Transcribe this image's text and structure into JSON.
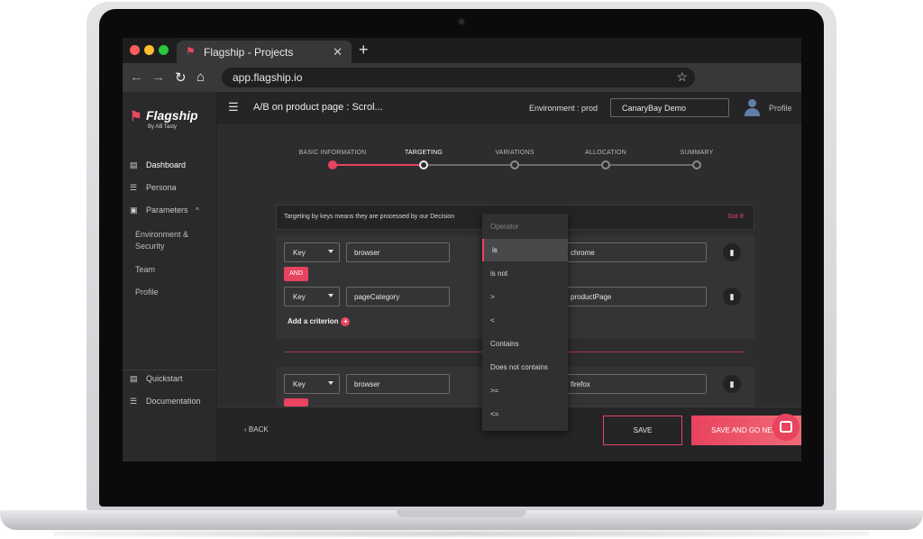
{
  "browser": {
    "tab_title": "Flagship - Projects",
    "url": "app.flagship.io"
  },
  "sidebar": {
    "logo_name": "Flagship",
    "logo_tagline": "By AB Tasty",
    "items": [
      {
        "label": "Dashboard"
      },
      {
        "label": "Persona"
      },
      {
        "label": "Parameters"
      },
      {
        "label": "Environment & Security"
      },
      {
        "label": "Team"
      },
      {
        "label": "Profile"
      },
      {
        "label": "Quickstart"
      },
      {
        "label": "Documentation"
      }
    ]
  },
  "header": {
    "title": "A/B on product page : Scrol...",
    "environment_label": "Environment : prod",
    "environment_value": "CanaryBay Demo",
    "profile_label": "Profile"
  },
  "stepper": {
    "steps": [
      {
        "label": "BASIC INFORMATION",
        "state": "done"
      },
      {
        "label": "TARGETING",
        "state": "current"
      },
      {
        "label": "VARIATIONS",
        "state": "todo"
      },
      {
        "label": "ALLOCATION",
        "state": "todo"
      },
      {
        "label": "SUMMARY",
        "state": "todo"
      }
    ]
  },
  "banner": {
    "text": "Targeting by keys means they are processed by our Decision",
    "dismiss_label": "Got it!"
  },
  "criteria": {
    "group1": [
      {
        "type": "Key",
        "key": "browser",
        "value": "chrome"
      },
      {
        "type": "Key",
        "key": "pageCategory",
        "value": "productPage"
      }
    ],
    "group2": [
      {
        "type": "Key",
        "key": "browser",
        "value": "firefox"
      }
    ],
    "and_label": "AND",
    "add_label": "Add a criterion"
  },
  "operator_menu": {
    "header": "Operator",
    "options": [
      "is",
      "is not",
      ">",
      "<",
      "Contains",
      "Does not contains",
      ">=",
      "<="
    ],
    "selected": "is"
  },
  "footer": {
    "back_label": "BACK",
    "save_label": "SAVE",
    "save_next_label": "SAVE AND GO NEXT"
  },
  "colors": {
    "accent": "#e8435f",
    "background": "#2d2d2f",
    "panel": "#343436"
  }
}
